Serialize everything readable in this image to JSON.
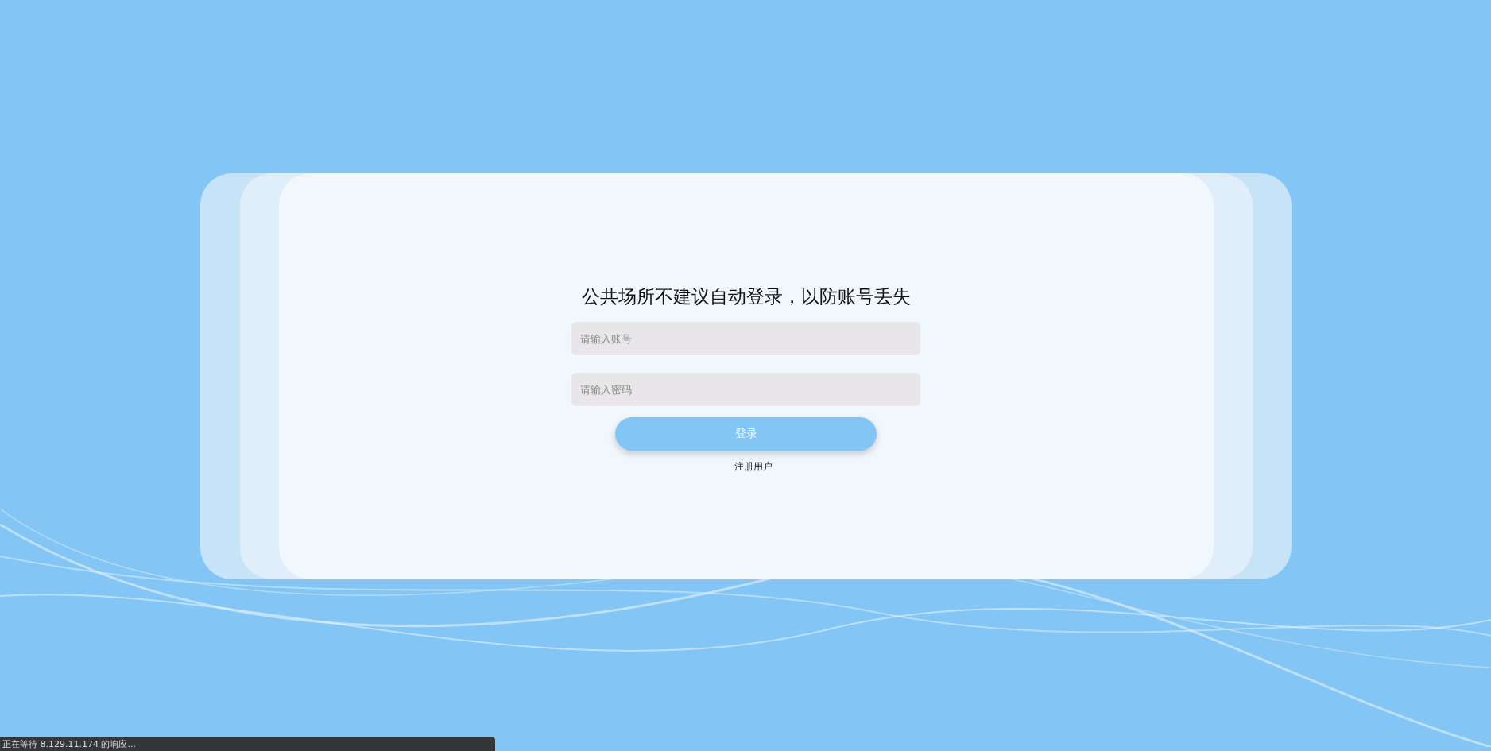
{
  "login": {
    "title": "公共场所不建议自动登录，以防账号丢失",
    "fields": [
      {
        "placeholder": "请输入账号"
      },
      {
        "placeholder": "请输入密码"
      }
    ],
    "button": "登录",
    "register_link": "注册用户"
  },
  "status_bar": "正在等待 8.129.11.174 的响应..."
}
